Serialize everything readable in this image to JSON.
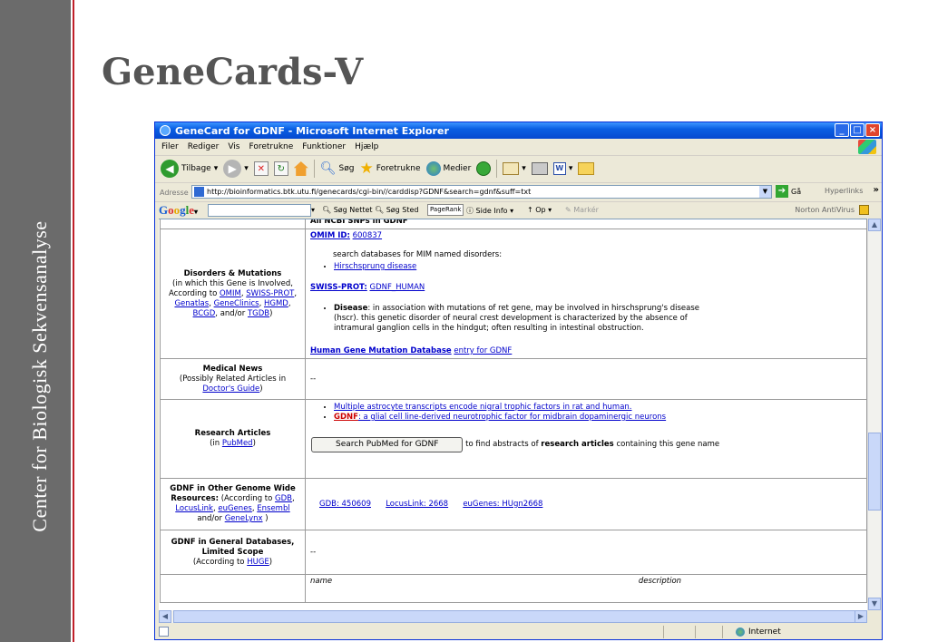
{
  "slide": {
    "side_text": "Center for Biologisk Sekvensanalyse",
    "title": "GeneCards-V"
  },
  "window": {
    "title": "GeneCard for GDNF - Microsoft Internet Explorer",
    "buttons": {
      "minimize": "_",
      "maximize": "□",
      "close": "×"
    }
  },
  "menu": {
    "items": [
      "Filer",
      "Rediger",
      "Vis",
      "Foretrukne",
      "Funktioner",
      "Hjælp"
    ]
  },
  "toolbar": {
    "back": "Tilbage",
    "search": "Søg",
    "favorites": "Foretrukne",
    "media": "Medier"
  },
  "address": {
    "label": "Adresse",
    "url": "http://bioinformatics.btk.utu.fi/genecards/cgi-bin//carddisp?GDNF&search=gdnf&suff=txt",
    "go": "Gå",
    "links": "Hyperlinks"
  },
  "google_bar": {
    "search_web": "Søg Nettet",
    "search_site": "Søg Sted",
    "pagerank": "PageRank",
    "page_info": "Side Info",
    "up": "Op",
    "highlight": "Markér",
    "norton": "Norton AntiVirus"
  },
  "content": {
    "cut_row": {
      "value": "All NCBI SNPs in GDNF"
    },
    "disorders": {
      "label_title": "Disorders & Mutations",
      "label_line1": "(in which this Gene is Involved,",
      "label_line2": "According to",
      "label_omim": "OMIM",
      "label_swiss": "SWISS-PROT",
      "label_genatlas": "Genatlas",
      "label_geneclinics": "GeneClinics",
      "label_hgmd": "HGMD",
      "label_bcgd": "BCGD",
      "label_andor": "and/or",
      "label_tgdb": "TGDB",
      "omim_label": "OMIM ID:",
      "omim_id": "600837",
      "search_text": "search databases for MIM named disorders:",
      "hirsch": "Hirschsprung disease",
      "swiss_label": "SWISS-PROT:",
      "swiss_id": "GDNF_HUMAN",
      "disease_label": "Disease",
      "disease_line1": ": in association with mutations of ret gene, may be involved in hirschsprung's disease",
      "disease_line2": "(hscr). this genetic disorder of neural crest development is characterized by the absence of",
      "disease_line3": "intramural ganglion cells in the hindgut; often resulting in intestinal obstruction.",
      "hgmd_label": "Human Gene Mutation Database",
      "hgmd_suffix": "entry for GDNF"
    },
    "news": {
      "label_title": "Medical News",
      "label_line1": "(Possibly Related Articles in",
      "label_link": "Doctor's Guide",
      "value": "--"
    },
    "research": {
      "label_title": "Research Articles",
      "label_in": "(in",
      "label_link": "PubMed",
      "article1": "Multiple astrocyte transcripts encode nigral trophic factors in rat and human.",
      "article2_name": "GDNF",
      "article2_rest": ": a glial cell line-derived neurotrophic factor for midbrain dopaminergic neurons",
      "button": "Search PubMed for GDNF",
      "find_text": " to find abstracts of ",
      "find_bold": "research articles",
      "find_end": " containing this gene name"
    },
    "other_genomes": {
      "label_bold": "GDNF in Other Genome Wide Resources:",
      "label_according": "(According to",
      "label_gdb": "GDB",
      "label_locuslink": "LocusLink",
      "label_eugenes": "euGenes",
      "label_ensembl": "Ensembl",
      "label_andor": "and/or",
      "label_genelynx": "GeneLynx",
      "gdb": "GDB: 450609",
      "locuslink": "LocusLink: 2668",
      "eugenes": "euGenes: HUgn2668"
    },
    "general_db": {
      "label_title": "GDNF in General Databases, Limited Scope",
      "label_according": "(According to",
      "label_link": "HUGE",
      "value": "--"
    },
    "last_row": {
      "name": "name",
      "description": "description"
    }
  },
  "status": {
    "zone": "Internet"
  }
}
